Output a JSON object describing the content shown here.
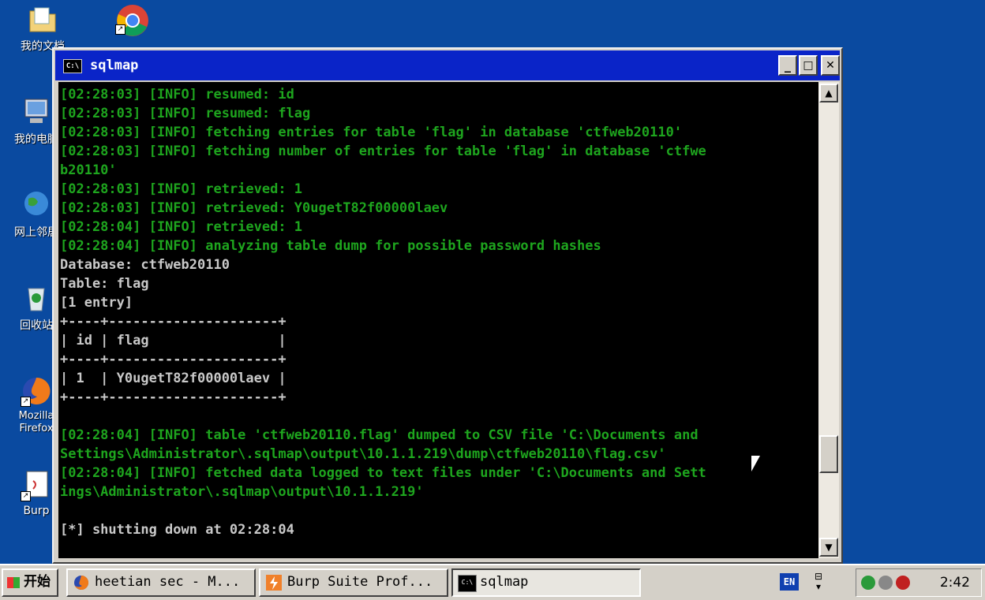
{
  "desktop": {
    "icons": [
      {
        "label": "我的文档"
      },
      {
        "label": ""
      },
      {
        "label": "我的电脑"
      },
      {
        "label": "网上邻居"
      },
      {
        "label": "回收站"
      },
      {
        "label": "Mozilla Firefox"
      },
      {
        "label": "Burp"
      }
    ]
  },
  "window": {
    "title": "sqlmap",
    "controls": {
      "minimize": "_",
      "maximize": "□",
      "close": "✕"
    }
  },
  "console": {
    "lines": [
      {
        "text": "[02:28:03] [INFO] resumed: id",
        "color": "green"
      },
      {
        "text": "[02:28:03] [INFO] resumed: flag",
        "color": "green"
      },
      {
        "text": "[02:28:03] [INFO] fetching entries for table 'flag' in database 'ctfweb20110'",
        "color": "green"
      },
      {
        "text": "[02:28:03] [INFO] fetching number of entries for table 'flag' in database 'ctfwe",
        "color": "green"
      },
      {
        "text": "b20110'",
        "color": "green"
      },
      {
        "text": "[02:28:03] [INFO] retrieved: 1",
        "color": "green"
      },
      {
        "text": "[02:28:03] [INFO] retrieved: Y0ugetT82f00000laev",
        "color": "green"
      },
      {
        "text": "[02:28:04] [INFO] retrieved: 1",
        "color": "green"
      },
      {
        "text": "[02:28:04] [INFO] analyzing table dump for possible password hashes",
        "color": "green"
      },
      {
        "text": "Database: ctfweb20110",
        "color": "white"
      },
      {
        "text": "Table: flag",
        "color": "white"
      },
      {
        "text": "[1 entry]",
        "color": "white"
      },
      {
        "text": "+----+---------------------+",
        "color": "white"
      },
      {
        "text": "| id | flag                |",
        "color": "white"
      },
      {
        "text": "+----+---------------------+",
        "color": "white"
      },
      {
        "text": "| 1  | Y0ugetT82f00000laev |",
        "color": "white"
      },
      {
        "text": "+----+---------------------+",
        "color": "white"
      },
      {
        "text": "",
        "color": "white"
      },
      {
        "text": "[02:28:04] [INFO] table 'ctfweb20110.flag' dumped to CSV file 'C:\\Documents and",
        "color": "green"
      },
      {
        "text": "Settings\\Administrator\\.sqlmap\\output\\10.1.1.219\\dump\\ctfweb20110\\flag.csv'",
        "color": "green"
      },
      {
        "text": "[02:28:04] [INFO] fetched data logged to text files under 'C:\\Documents and Sett",
        "color": "green"
      },
      {
        "text": "ings\\Administrator\\.sqlmap\\output\\10.1.1.219'",
        "color": "green"
      },
      {
        "text": "",
        "color": "white"
      },
      {
        "text": "[*] shutting down at 02:28:04",
        "color": "white"
      }
    ]
  },
  "taskbar": {
    "start_label": "开始",
    "tasks": [
      {
        "label": "heetian sec - M...",
        "icon": "firefox-icon",
        "active": false
      },
      {
        "label": "Burp Suite Prof...",
        "icon": "burp-icon",
        "active": false
      },
      {
        "label": "sqlmap",
        "icon": "console-icon",
        "active": true
      }
    ],
    "language": "EN",
    "clock": "2:42"
  }
}
